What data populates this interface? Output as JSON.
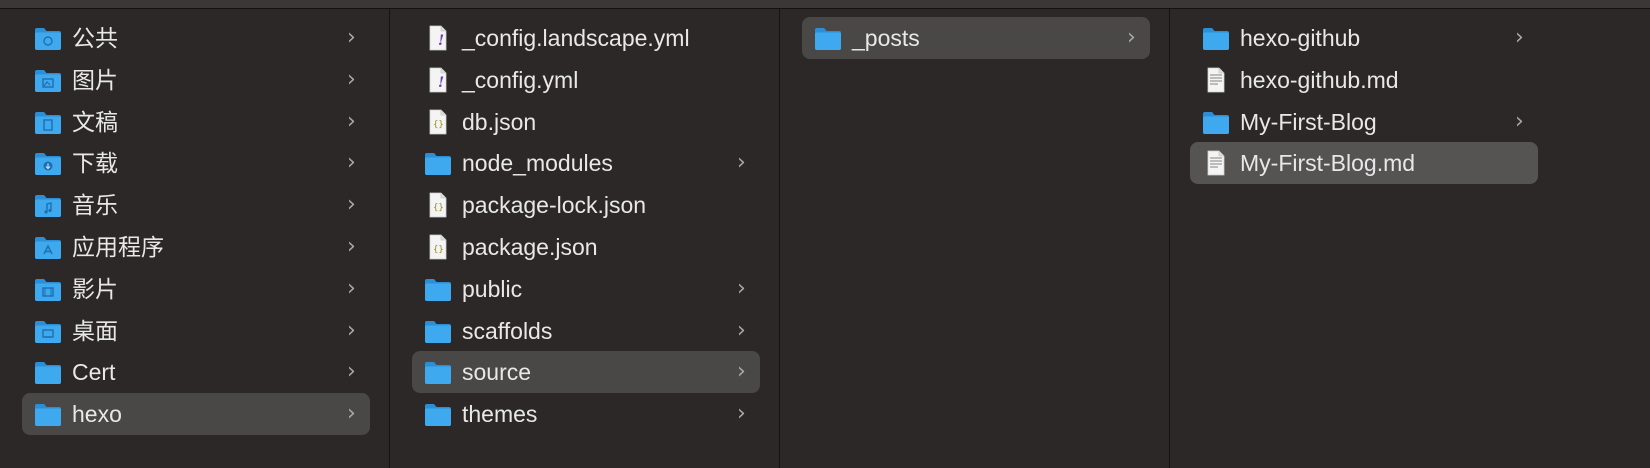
{
  "columns": [
    {
      "name": "sidebar-locations",
      "items": [
        {
          "label": "公共",
          "icon": "folder-public-icon",
          "chevron": true
        },
        {
          "label": "图片",
          "icon": "folder-pictures-icon",
          "chevron": true
        },
        {
          "label": "文稿",
          "icon": "folder-documents-icon",
          "chevron": true
        },
        {
          "label": "下载",
          "icon": "folder-downloads-icon",
          "chevron": true
        },
        {
          "label": "音乐",
          "icon": "folder-music-icon",
          "chevron": true
        },
        {
          "label": "应用程序",
          "icon": "folder-applications-icon",
          "chevron": true
        },
        {
          "label": "影片",
          "icon": "folder-movies-icon",
          "chevron": true
        },
        {
          "label": "桌面",
          "icon": "folder-desktop-icon",
          "chevron": true
        },
        {
          "label": "Cert",
          "icon": "folder-icon",
          "chevron": true
        },
        {
          "label": "hexo",
          "icon": "folder-icon",
          "chevron": true,
          "selected": true
        }
      ]
    },
    {
      "name": "hexo-contents",
      "items": [
        {
          "label": "_config.landscape.yml",
          "icon": "yaml-file-icon",
          "chevron": false
        },
        {
          "label": "_config.yml",
          "icon": "yaml-file-icon",
          "chevron": false
        },
        {
          "label": "db.json",
          "icon": "json-file-icon",
          "chevron": false
        },
        {
          "label": "node_modules",
          "icon": "folder-icon",
          "chevron": true
        },
        {
          "label": "package-lock.json",
          "icon": "json-file-icon",
          "chevron": false
        },
        {
          "label": "package.json",
          "icon": "json-file-icon",
          "chevron": false
        },
        {
          "label": "public",
          "icon": "folder-icon",
          "chevron": true
        },
        {
          "label": "scaffolds",
          "icon": "folder-icon",
          "chevron": true
        },
        {
          "label": "source",
          "icon": "folder-icon",
          "chevron": true,
          "selected": true
        },
        {
          "label": "themes",
          "icon": "folder-icon",
          "chevron": true
        }
      ]
    },
    {
      "name": "source-contents",
      "items": [
        {
          "label": "_posts",
          "icon": "folder-icon",
          "chevron": true,
          "selected": true
        }
      ]
    },
    {
      "name": "posts-contents",
      "items": [
        {
          "label": "hexo-github",
          "icon": "folder-icon",
          "chevron": true
        },
        {
          "label": "hexo-github.md",
          "icon": "markdown-file-icon",
          "chevron": false
        },
        {
          "label": "My-First-Blog",
          "icon": "folder-icon",
          "chevron": true
        },
        {
          "label": "My-First-Blog.md",
          "icon": "markdown-file-icon",
          "chevron": false,
          "selected": true,
          "dim": true
        }
      ]
    }
  ],
  "colors": {
    "folder": "#3fa9f0",
    "selection": "#4a4747",
    "background": "#2b2827"
  }
}
